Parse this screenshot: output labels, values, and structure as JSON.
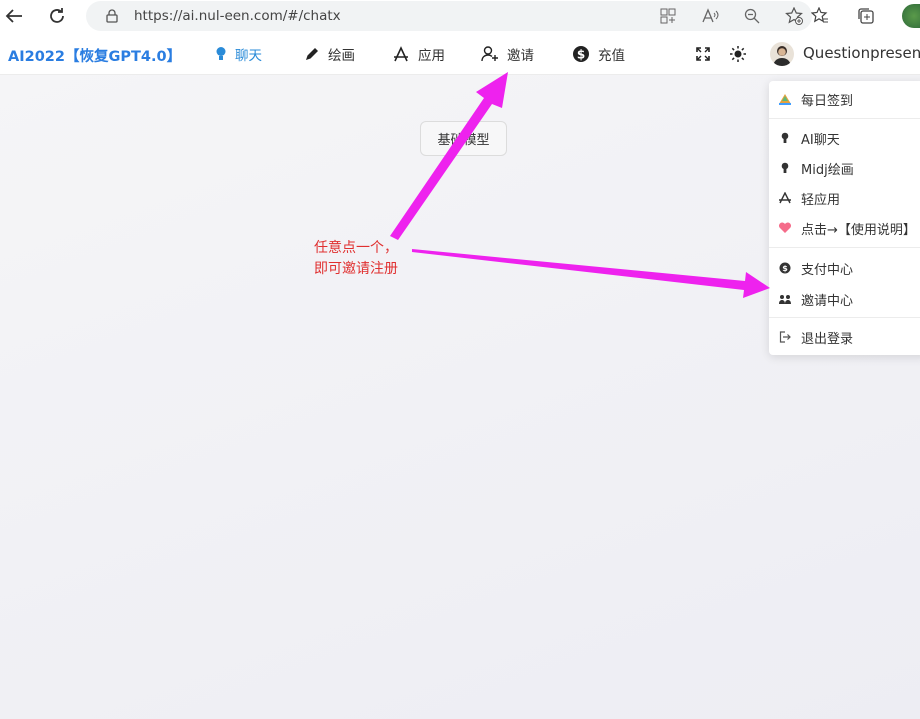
{
  "browser": {
    "url": "https://ai.nul-een.com/#/chatx",
    "icons": [
      "back-icon",
      "refresh-icon",
      "lock-icon",
      "apps-icon",
      "read-aloud-icon",
      "zoom-icon",
      "favorite-add-icon",
      "favorites-icon",
      "collections-icon",
      "profile-icon"
    ]
  },
  "header": {
    "brand": "AI2022【恢复GPT4.0】",
    "nav": [
      {
        "label": "聊天",
        "icon": "lightbulb-icon",
        "active": true
      },
      {
        "label": "绘画",
        "icon": "pencil-icon"
      },
      {
        "label": "应用",
        "icon": "app-store-icon"
      },
      {
        "label": "邀请",
        "icon": "user-add-icon"
      },
      {
        "label": "充值",
        "icon": "dollar-icon"
      }
    ],
    "icons": [
      "fullscreen-icon",
      "theme-sun-icon"
    ],
    "user": {
      "name": "Questionpresenter"
    }
  },
  "main": {
    "model_button": "基础模型"
  },
  "annotation": {
    "line1": "任意点一个，",
    "line2": "即可邀请注册",
    "color": "#e03030",
    "arrow_color": "#ee22ee"
  },
  "dropdown": {
    "items": [
      {
        "label": "每日签到",
        "icon": "checkin-icon"
      },
      {
        "label": "AI聊天",
        "icon": "bulb-icon"
      },
      {
        "label": "Midj绘画",
        "icon": "bulb-icon"
      },
      {
        "label": "轻应用",
        "icon": "app-store-icon"
      },
      {
        "label": "点击→【使用说明】",
        "icon": "heart-icon"
      },
      {
        "label": "支付中心",
        "icon": "dollar-icon"
      },
      {
        "label": "邀请中心",
        "icon": "invite-icon"
      },
      {
        "label": "退出登录",
        "icon": "logout-icon"
      }
    ]
  },
  "colors": {
    "brand": "#2a7de1",
    "active_nav": "#2a8bd8"
  }
}
